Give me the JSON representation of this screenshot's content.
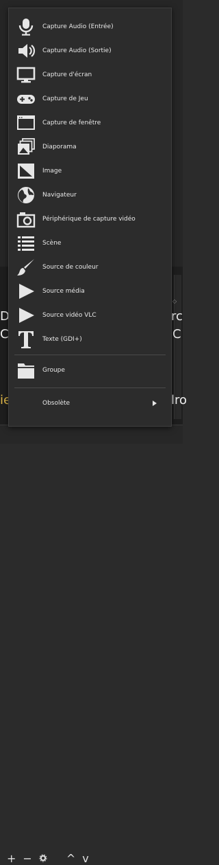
{
  "menu": {
    "items": [
      {
        "label": "Capture Audio (Entrée)",
        "icon": "microphone-icon"
      },
      {
        "label": "Capture Audio (Sortie)",
        "icon": "speaker-icon"
      },
      {
        "label": "Capture d'écran",
        "icon": "monitor-icon"
      },
      {
        "label": "Capture de Jeu",
        "icon": "gamepad-icon"
      },
      {
        "label": "Capture de fenêtre",
        "icon": "window-icon"
      },
      {
        "label": "Diaporama",
        "icon": "slideshow-icon"
      },
      {
        "label": "Image",
        "icon": "image-icon"
      },
      {
        "label": "Navigateur",
        "icon": "globe-icon"
      },
      {
        "label": "Périphérique de capture vidéo",
        "icon": "camera-icon"
      },
      {
        "label": "Scène",
        "icon": "list-icon"
      },
      {
        "label": "Source de couleur",
        "icon": "paintbrush-icon"
      },
      {
        "label": "Source média",
        "icon": "play-icon"
      },
      {
        "label": "Source vidéo VLC",
        "icon": "play-icon"
      },
      {
        "label": "Texte (GDI+)",
        "icon": "text-icon"
      },
      {
        "label": "Groupe",
        "icon": "folder-icon"
      },
      {
        "label": "Obsolète",
        "icon": "chevron-right-icon"
      }
    ]
  },
  "background": {
    "left_letter": "D",
    "right_letters": "rc",
    "left_letter_2": "C",
    "right_letter_2": "C",
    "left_letter_3": "ie",
    "right_letters_3": "lro"
  },
  "toolbar": {
    "add": "+",
    "remove": "−",
    "up": "^",
    "down": "v"
  }
}
